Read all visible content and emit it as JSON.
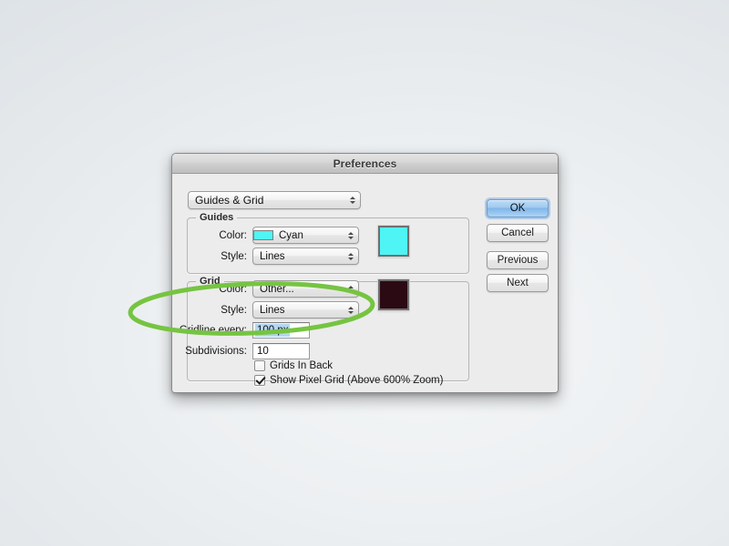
{
  "window": {
    "title": "Preferences"
  },
  "section_popup": {
    "selected": "Guides & Grid",
    "stepper_up_icon": "stepper-up-arrow",
    "stepper_down_icon": "stepper-down-arrow"
  },
  "guides": {
    "legend": "Guides",
    "color": {
      "label": "Color:",
      "value": "Cyan",
      "swatch_hex": "#4FF4F4"
    },
    "style": {
      "label": "Style:",
      "value": "Lines"
    }
  },
  "grid": {
    "legend": "Grid",
    "color": {
      "label": "Color:",
      "value": "Other...",
      "swatch_hex": "#2B0A13"
    },
    "style": {
      "label": "Style:",
      "value": "Lines"
    },
    "gridline_every": {
      "label": "Gridline every:",
      "value": "100 px",
      "selected": true
    },
    "subdivisions": {
      "label": "Subdivisions:",
      "value": "10",
      "selected": false
    },
    "grids_in_back": {
      "label": "Grids In Back",
      "checked": false
    },
    "show_pixel_grid": {
      "label": "Show Pixel Grid (Above 600% Zoom)",
      "checked": true
    }
  },
  "buttons": {
    "ok": "OK",
    "cancel": "Cancel",
    "previous": "Previous",
    "next": "Next"
  },
  "annotation": {
    "shape": "ellipse-highlight",
    "color_hex": "#76C442",
    "stroke_width": 5
  }
}
